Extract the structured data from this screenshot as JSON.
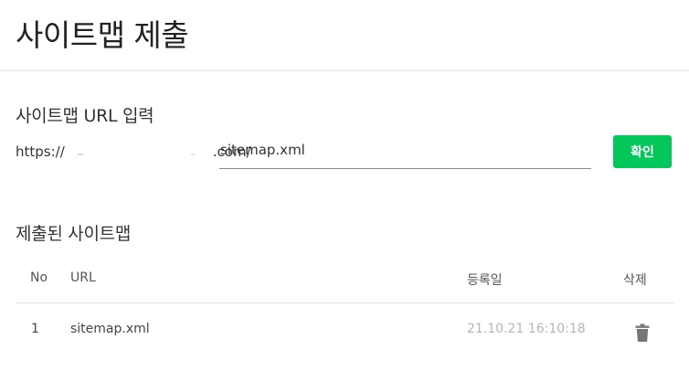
{
  "header": {
    "title": "사이트맵 제출"
  },
  "url_section": {
    "heading": "사이트맵 URL 입력",
    "prefix_start": "https://",
    "prefix_end": ".com/",
    "input_value": "sitemap.xml",
    "confirm_label": "확인"
  },
  "submitted_section": {
    "heading": "제출된 사이트맵",
    "columns": {
      "no": "No",
      "url": "URL",
      "date": "등록일",
      "delete": "삭제"
    },
    "rows": [
      {
        "no": "1",
        "url": "sitemap.xml",
        "date": "21.10.21 16:10:18",
        "delete_icon": "trash-icon"
      }
    ]
  },
  "colors": {
    "accent": "#03c75a",
    "date_text": "#b5b5b5",
    "divider": "#e4e4e4"
  }
}
